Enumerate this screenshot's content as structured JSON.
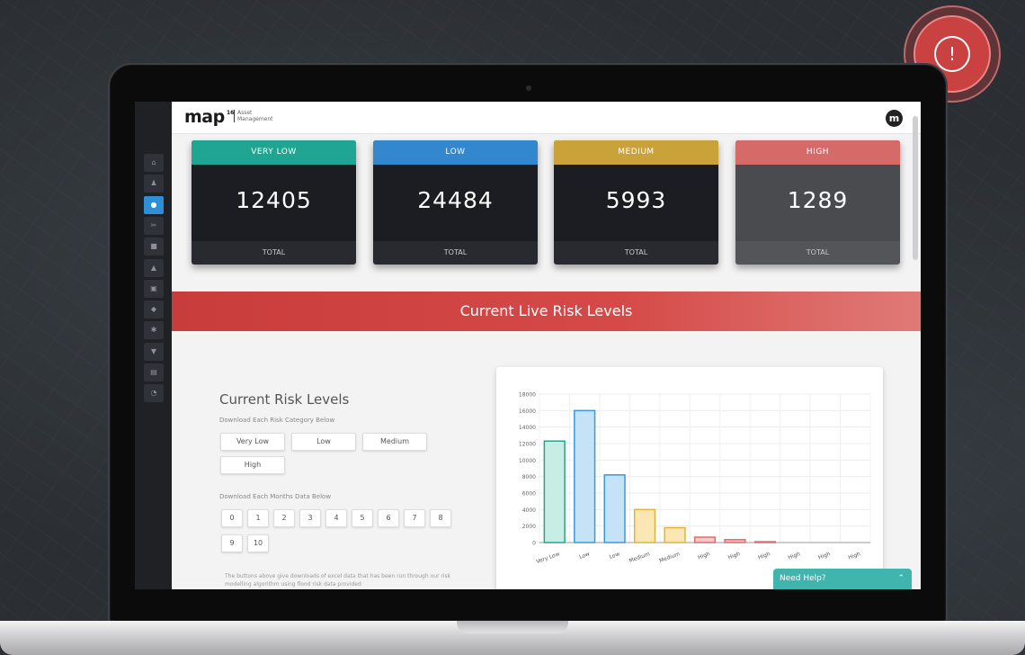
{
  "alert": {
    "symbol": "!"
  },
  "header": {
    "logo": "map",
    "logo_superscript": "16",
    "logo_subtitle": "Asset Management",
    "avatar_letter": "m"
  },
  "sidebar": {
    "icons": [
      {
        "name": "home-icon",
        "glyph": "⌂",
        "active": false
      },
      {
        "name": "user-icon",
        "glyph": "♟",
        "active": false
      },
      {
        "name": "water-drop-icon",
        "glyph": "●",
        "active": true
      },
      {
        "name": "network-icon",
        "glyph": "✂",
        "active": false
      },
      {
        "name": "document-icon",
        "glyph": "■",
        "active": false
      },
      {
        "name": "alert-icon",
        "glyph": "▲",
        "active": false
      },
      {
        "name": "calendar-icon",
        "glyph": "▣",
        "active": false
      },
      {
        "name": "shield-icon",
        "glyph": "◆",
        "active": false
      },
      {
        "name": "settings-icon",
        "glyph": "✱",
        "active": false
      },
      {
        "name": "download-icon",
        "glyph": "▼",
        "active": false
      },
      {
        "name": "table-icon",
        "glyph": "▤",
        "active": false
      },
      {
        "name": "chat-icon",
        "glyph": "◔",
        "active": false
      }
    ]
  },
  "cards": [
    {
      "label": "VERY LOW",
      "value": "12405",
      "footer": "TOTAL",
      "color": "#1fa592"
    },
    {
      "label": "LOW",
      "value": "24484",
      "footer": "TOTAL",
      "color": "#3287cf"
    },
    {
      "label": "MEDIUM",
      "value": "5993",
      "footer": "TOTAL",
      "color": "#c9a33a"
    },
    {
      "label": "HIGH",
      "value": "1289",
      "footer": "TOTAL",
      "color": "#d56a68"
    }
  ],
  "banner": {
    "title": "Current Live Risk Levels"
  },
  "risk_panel": {
    "title": "Current Risk Levels",
    "category_prompt": "Download Each Risk Category Below",
    "category_buttons": [
      "Very Low",
      "Low",
      "Medium",
      "High"
    ],
    "month_prompt": "Download Each Months Data Below",
    "month_buttons": [
      "0",
      "1",
      "2",
      "3",
      "4",
      "5",
      "6",
      "7",
      "8",
      "9",
      "10"
    ],
    "note": "The buttons above give downloads of excel data that has been run through our risk modelling algorithm using flood risk data provided"
  },
  "help": {
    "label": "Need Help?",
    "chevron": "⌃"
  },
  "chart_data": {
    "type": "bar",
    "categories": [
      "Very Low",
      "Low",
      "Low",
      "Medium",
      "Medium",
      "High",
      "High",
      "High",
      "High",
      "High",
      "High"
    ],
    "values": [
      12300,
      16000,
      8200,
      4000,
      1800,
      650,
      350,
      100,
      0,
      0,
      0
    ],
    "bar_fills": [
      "#c7ede4",
      "#c6e2f6",
      "#c6e2f6",
      "#fbe7b4",
      "#fbe7b4",
      "#f8c7c7",
      "#f8c7c7",
      "#f8c7c7",
      "#f8c7c7",
      "#f8c7c7",
      "#f8c7c7"
    ],
    "bar_strokes": [
      "#27a58c",
      "#3a9ad9",
      "#3a9ad9",
      "#e2b33b",
      "#e2b33b",
      "#e06b6b",
      "#e06b6b",
      "#e06b6b",
      "#e06b6b",
      "#e06b6b",
      "#e06b6b"
    ],
    "y_ticks": [
      0,
      2000,
      4000,
      6000,
      8000,
      10000,
      12000,
      14000,
      16000,
      18000
    ],
    "ylim": [
      0,
      18000
    ],
    "grid": true,
    "title": "",
    "xlabel": "",
    "ylabel": ""
  }
}
